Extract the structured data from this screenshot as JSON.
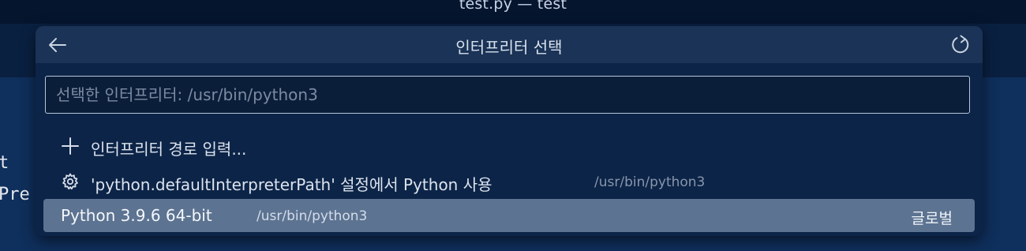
{
  "window": {
    "title": "test.py — test"
  },
  "editor": {
    "code_fragments": [
      "t",
      "Pre"
    ]
  },
  "quick_pick": {
    "title": "인터프리터 선택",
    "back_icon": "arrow-left-icon",
    "refresh_icon": "refresh-icon",
    "input": {
      "value": "",
      "placeholder": "선택한 인터프리터: /usr/bin/python3"
    },
    "items": [
      {
        "icon": "plus-icon",
        "label": "인터프리터 경로 입력...",
        "description": "",
        "badge": ""
      },
      {
        "icon": "gear-icon",
        "label": "'python.defaultInterpreterPath' 설정에서 Python 사용",
        "description": "/usr/bin/python3",
        "badge": ""
      },
      {
        "label": "Python 3.9.6 64-bit",
        "description": "/usr/bin/python3",
        "badge": "글로벌",
        "selected": true
      }
    ]
  },
  "colors": {
    "palette_bg": "#0c2447",
    "header_bg": "#1a3356",
    "selected_bg": "#5c7391",
    "input_border": "#b7c6dc"
  }
}
